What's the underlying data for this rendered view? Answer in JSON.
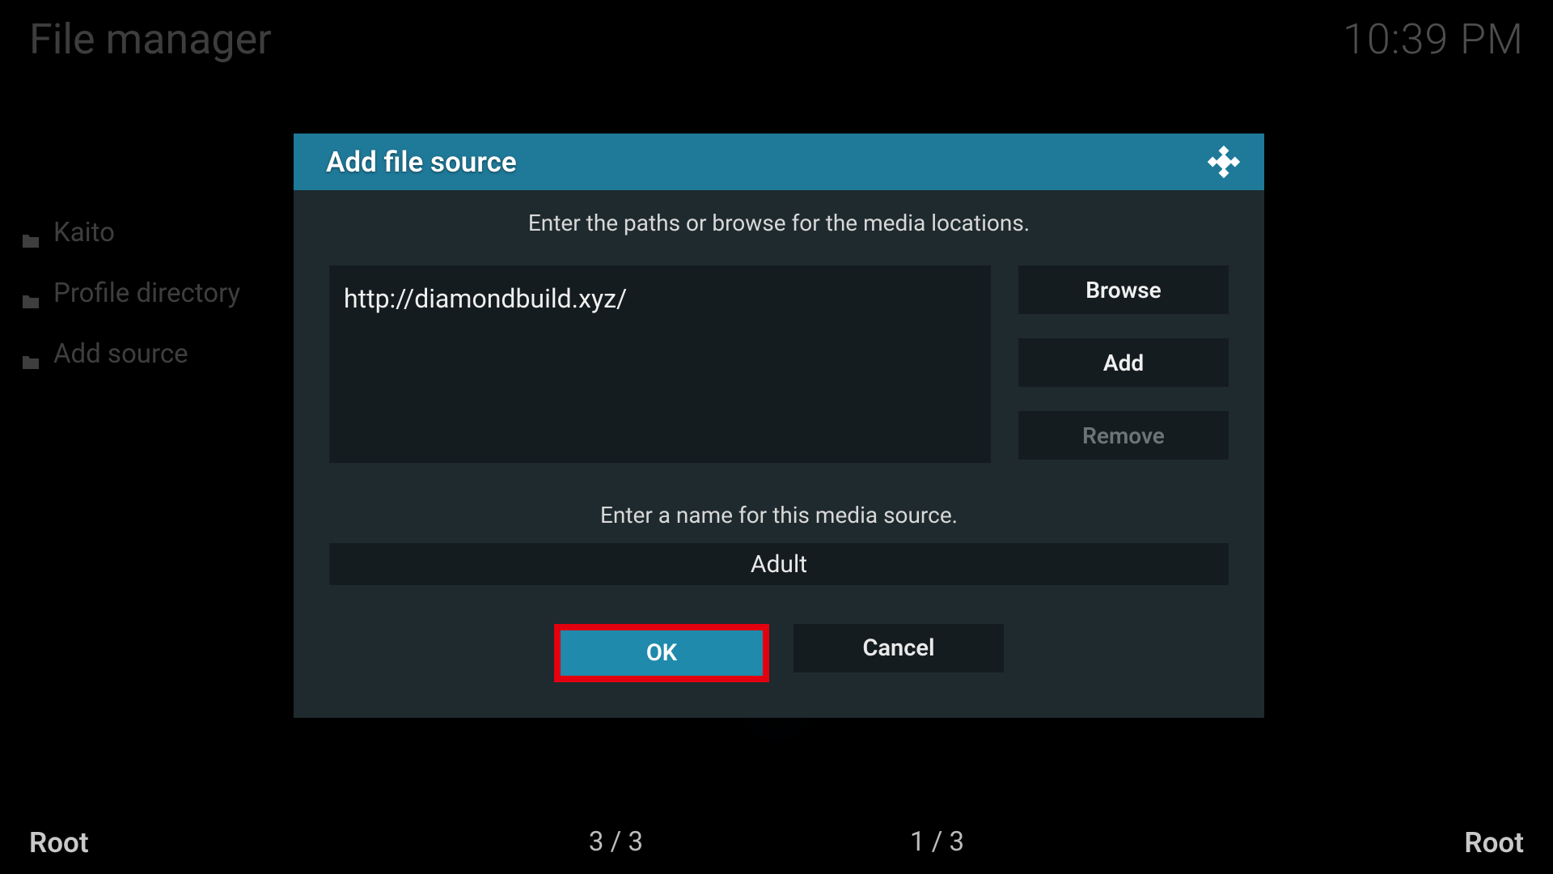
{
  "header": {
    "title": "File manager",
    "clock": "10:39 PM"
  },
  "sidebar": {
    "items": [
      {
        "label": "Kaito"
      },
      {
        "label": "Profile directory"
      },
      {
        "label": "Add source"
      }
    ]
  },
  "footer": {
    "left_label": "Root",
    "left_count": "3 / 3",
    "right_count": "1 / 3",
    "right_label": "Root"
  },
  "dialog": {
    "title": "Add file source",
    "path_instruction": "Enter the paths or browse for the media locations.",
    "path_value": "http://diamondbuild.xyz/",
    "browse_label": "Browse",
    "add_label": "Add",
    "remove_label": "Remove",
    "name_instruction": "Enter a name for this media source.",
    "name_value": "Adult",
    "ok_label": "OK",
    "cancel_label": "Cancel"
  },
  "colors": {
    "dialog_header": "#1f7a99",
    "dialog_body": "#1f2a2e",
    "input_bg": "#151c1f",
    "highlight_border": "#e3000f",
    "ok_button": "#1f8aab"
  }
}
